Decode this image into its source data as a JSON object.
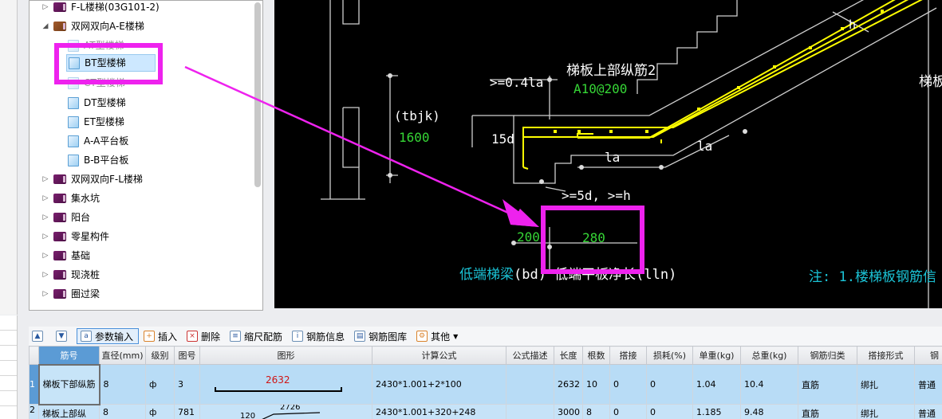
{
  "tree": {
    "items": [
      {
        "label": "F-L楼梯(03G101-2)",
        "type": "book",
        "expanded": false
      },
      {
        "label": "双网双向A-E楼梯",
        "type": "book-open",
        "expanded": true
      },
      {
        "label": "AT型楼梯",
        "type": "page"
      },
      {
        "label": "BT型楼梯",
        "type": "page",
        "selected": true
      },
      {
        "label": "CT型楼梯",
        "type": "page"
      },
      {
        "label": "DT型楼梯",
        "type": "page"
      },
      {
        "label": "ET型楼梯",
        "type": "page"
      },
      {
        "label": "A-A平台板",
        "type": "page"
      },
      {
        "label": "B-B平台板",
        "type": "page"
      },
      {
        "label": "双网双向F-L楼梯",
        "type": "book",
        "expanded": false
      },
      {
        "label": "集水坑",
        "type": "book",
        "expanded": false
      },
      {
        "label": "阳台",
        "type": "book",
        "expanded": false
      },
      {
        "label": "零星构件",
        "type": "book",
        "expanded": false
      },
      {
        "label": "基础",
        "type": "book",
        "expanded": false
      },
      {
        "label": "现浇桩",
        "type": "book",
        "expanded": false
      },
      {
        "label": "圈过梁",
        "type": "book",
        "expanded": false
      }
    ]
  },
  "drawing": {
    "top_bar_label": "梯板上部纵筋2",
    "top_bar_spec": "A10@200",
    "right_label": "梯板",
    "anchor_041": ">=0.4la",
    "tbjk": "(tbjk)",
    "tbjk_value": "1600",
    "d15": "15d",
    "la1": "la",
    "la2": "la",
    "h": "h",
    "d5": ">=5d, >=h",
    "dim_200": "200",
    "dim_280": "280",
    "bottom_label_prefix": "低端梯梁",
    "bottom_label_rest": "(bd) 低端平板净长(lln)",
    "note": "注: 1.楼梯板钢筋信"
  },
  "toolbar": {
    "buttons": [
      {
        "label": "",
        "icon": "move-up-icon"
      },
      {
        "label": "",
        "icon": "move-down-icon"
      },
      {
        "label": "参数输入",
        "icon": "param-input-icon",
        "active": true
      },
      {
        "label": "插入",
        "icon": "insert-icon"
      },
      {
        "label": "删除",
        "icon": "delete-icon"
      },
      {
        "label": "缩尺配筋",
        "icon": "scale-rebar-icon"
      },
      {
        "label": "钢筋信息",
        "icon": "rebar-info-icon"
      },
      {
        "label": "钢筋图库",
        "icon": "rebar-library-icon"
      },
      {
        "label": "其他",
        "icon": "other-icon"
      }
    ]
  },
  "grid": {
    "headers": [
      "筋号",
      "直径(mm)",
      "级别",
      "图号",
      "图形",
      "计算公式",
      "公式描述",
      "长度",
      "根数",
      "搭接",
      "损耗(%)",
      "单重(kg)",
      "总重(kg)",
      "钢筋归类",
      "搭接形式",
      "钢"
    ],
    "rows": [
      {
        "num": "1",
        "cells": [
          "梯板下部纵筋",
          "8",
          "ф",
          "3",
          "2632",
          "2430*1.001+2*100",
          "",
          "2632",
          "10",
          "0",
          "0",
          "1.04",
          "10.4",
          "直筋",
          "绑扎",
          "普通"
        ]
      },
      {
        "num": "2",
        "cells": [
          "梯板上部纵",
          "8",
          "ф",
          "781",
          "2726",
          "2430*1.001+320+248",
          "",
          "3000",
          "8",
          "0",
          "0",
          "1.185",
          "9.48",
          "直筋",
          "绑扎",
          "普通"
        ]
      }
    ],
    "row2_shape_left": "120"
  },
  "colors": {
    "highlight": "#ee22ee",
    "rebar": "#ffff00",
    "green_text": "#36d636",
    "cyan_text": "#1bc3d6"
  }
}
